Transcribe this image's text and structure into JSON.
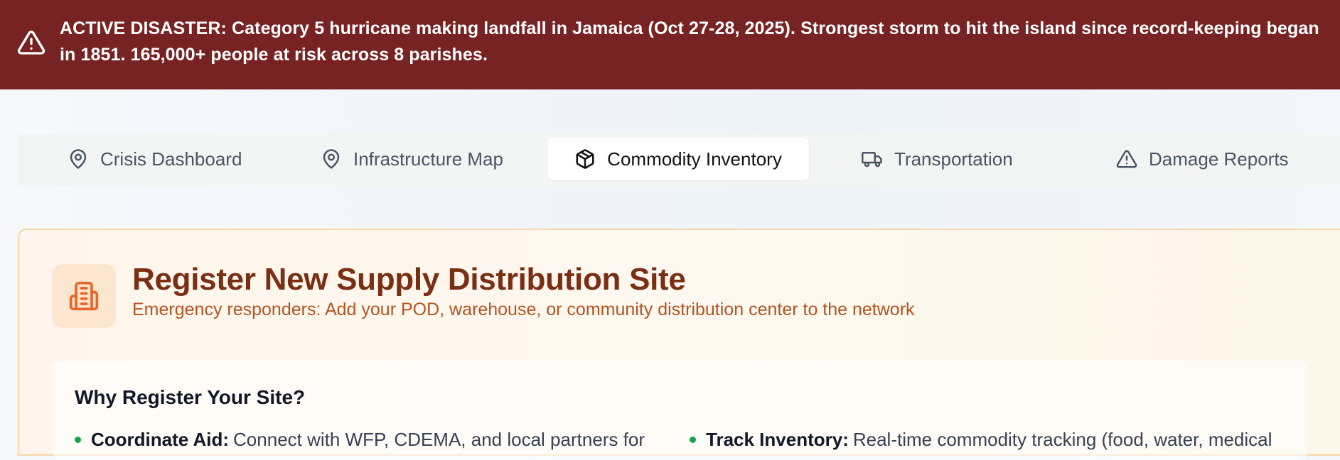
{
  "alert": {
    "icon": "warning-triangle-icon",
    "lead": "ACTIVE DISASTER:",
    "message": "Category 5 hurricane making landfall in Jamaica (Oct 27-28, 2025). Strongest storm to hit the island since record-keeping began in 1851. 165,000+ people at risk across 8 parishes.",
    "background": "#772323"
  },
  "tabs": [
    {
      "label": "Crisis Dashboard",
      "icon": "map-pin-icon",
      "active": false
    },
    {
      "label": "Infrastructure Map",
      "icon": "map-pin-icon",
      "active": false
    },
    {
      "label": "Commodity Inventory",
      "icon": "package-icon",
      "active": true
    },
    {
      "label": "Transportation",
      "icon": "truck-icon",
      "active": false
    },
    {
      "label": "Damage Reports",
      "icon": "warning-triangle-icon",
      "active": false
    }
  ],
  "register_card": {
    "icon": "building-icon",
    "title": "Register New Supply Distribution Site",
    "subtitle": "Emergency responders: Add your POD, warehouse, or community distribution center to the network",
    "why": {
      "title": "Why Register Your Site?",
      "bullets": [
        {
          "label": "Coordinate Aid:",
          "text": "Connect with WFP, CDEMA, and local partners for"
        },
        {
          "label": "Track Inventory:",
          "text": "Real-time commodity tracking (food, water, medical"
        }
      ]
    }
  }
}
